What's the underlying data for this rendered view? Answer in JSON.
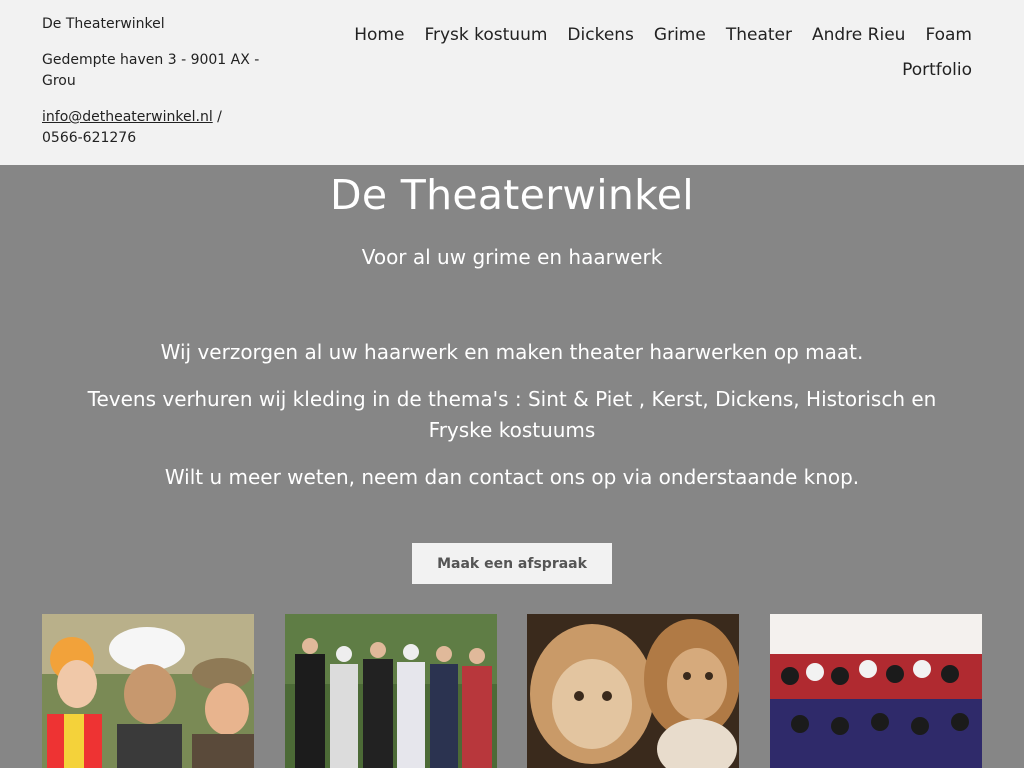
{
  "header": {
    "business_name": "De Theaterwinkel",
    "address": "Gedempte haven 3 - 9001 AX - Grou",
    "email": "info@detheaterwinkel.nl",
    "phone": " / 0566-621276"
  },
  "nav": {
    "items": [
      "Home",
      "Frysk kostuum",
      "Dickens",
      "Grime",
      "Theater",
      "Andre Rieu",
      "Foam",
      "Portfolio"
    ]
  },
  "hero": {
    "title": "De Theaterwinkel",
    "subtitle": "Voor al uw grime en haarwerk",
    "paragraphs": [
      "Wij verzorgen al uw haarwerk en maken theater haarwerken op maat.",
      "Tevens verhuren wij kleding in de thema's : Sint & Piet , Kerst, Dickens, Historisch en Fryske kostuums",
      "Wilt u meer weten, neem dan contact ons op via onderstaande knop."
    ],
    "cta_label": "Maak een afspraak"
  },
  "gallery": {
    "images": [
      "costumed-characters-photo",
      "historical-costumes-group-photo",
      "lion-makeup-photo",
      "sint-and-piet-group-photo"
    ]
  },
  "colors": {
    "header_bg": "#f2f2f2",
    "hero_bg": "#868686",
    "text_light": "#ffffff"
  }
}
